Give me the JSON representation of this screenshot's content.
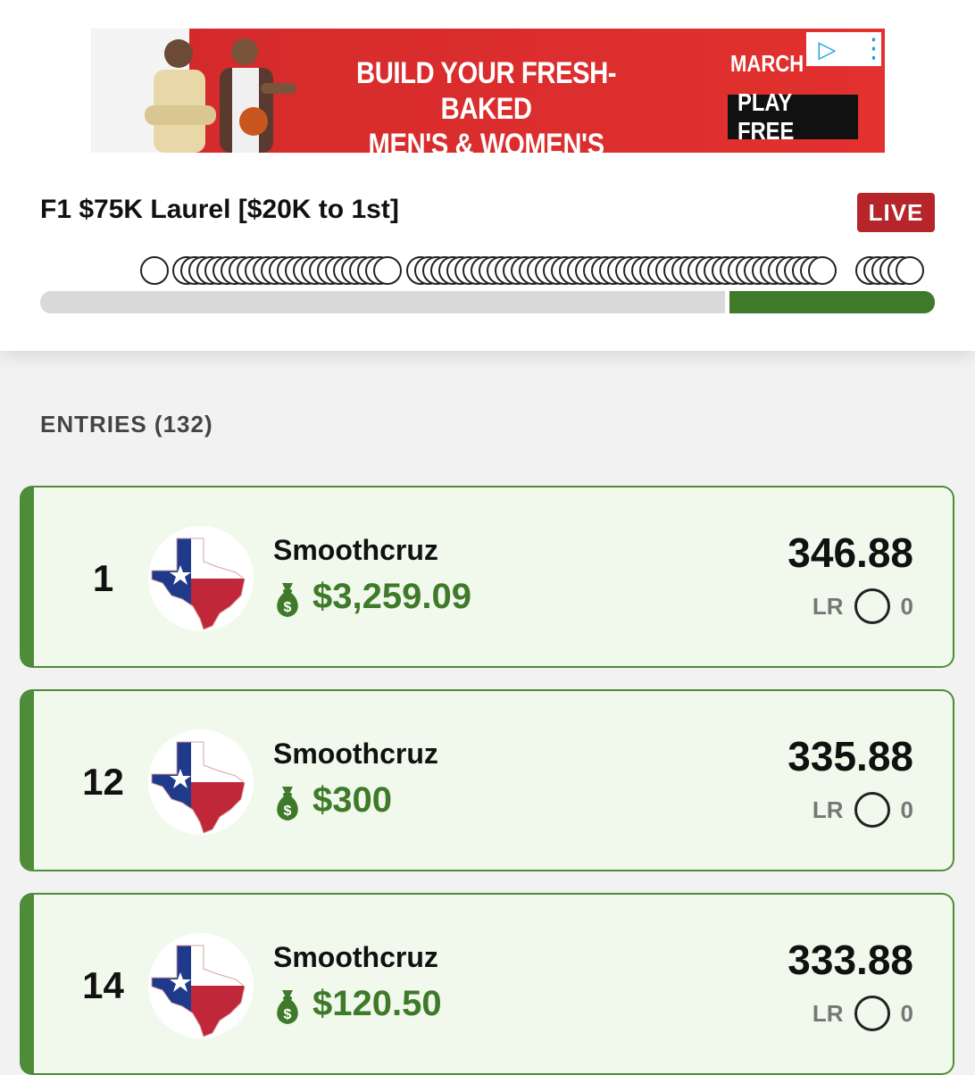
{
  "ad": {
    "headline_line1": "BUILD YOUR FRESH-BAKED",
    "headline_line2": "MEN'S & WOMEN'S BRACKETS",
    "month": "MARCH",
    "cta": "PLAY FREE",
    "adchoices_icon": "play-triangle-icon",
    "menu_icon": "vertical-dots-icon"
  },
  "contest": {
    "title": "F1 $75K Laurel [$20K to 1st]",
    "status": "LIVE",
    "progress_fraction_remaining": 0.23
  },
  "colors": {
    "brand_green": "#3f7a2a",
    "card_bg": "#f0f9ec",
    "live_red": "#b5252a"
  },
  "entries": {
    "header": "ENTRIES (132)",
    "list": [
      {
        "rank": "1",
        "name": "Smoothcruz",
        "winnings": "$3,259.09",
        "points": "346.88",
        "lr_label": "LR",
        "lr_value": "0",
        "avatar": "texas-flag-avatar"
      },
      {
        "rank": "12",
        "name": "Smoothcruz",
        "winnings": "$300",
        "points": "335.88",
        "lr_label": "LR",
        "lr_value": "0",
        "avatar": "texas-flag-avatar"
      },
      {
        "rank": "14",
        "name": "Smoothcruz",
        "winnings": "$120.50",
        "points": "333.88",
        "lr_label": "LR",
        "lr_value": "0",
        "avatar": "texas-flag-avatar"
      }
    ]
  }
}
